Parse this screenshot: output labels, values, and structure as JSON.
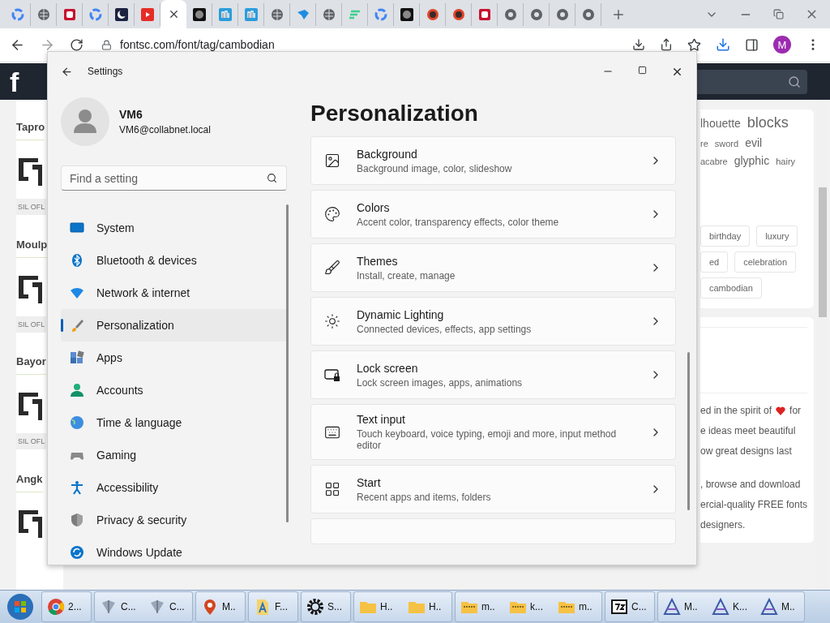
{
  "browser": {
    "tabs": [
      {
        "kind": "google",
        "selected": false
      },
      {
        "kind": "globe",
        "selected": false
      },
      {
        "kind": "red-frame",
        "selected": false
      },
      {
        "kind": "google",
        "selected": false
      },
      {
        "kind": "moon",
        "selected": false
      },
      {
        "kind": "video",
        "selected": false
      },
      {
        "kind": "blank",
        "selected": true
      },
      {
        "kind": "dark-seal",
        "selected": false
      },
      {
        "kind": "blue-tile",
        "selected": false
      },
      {
        "kind": "blue-tile",
        "selected": false
      },
      {
        "kind": "globe",
        "selected": false
      },
      {
        "kind": "blue-bird",
        "selected": false
      },
      {
        "kind": "globe",
        "selected": false
      },
      {
        "kind": "green-lines",
        "selected": false
      },
      {
        "kind": "google",
        "selected": false
      },
      {
        "kind": "dark-seal",
        "selected": false
      },
      {
        "kind": "red-dot",
        "selected": false
      },
      {
        "kind": "red-dot",
        "selected": false
      },
      {
        "kind": "red-frame",
        "selected": false
      },
      {
        "kind": "chrome",
        "selected": false
      },
      {
        "kind": "chrome",
        "selected": false
      },
      {
        "kind": "chrome",
        "selected": false
      },
      {
        "kind": "chrome",
        "selected": false
      }
    ],
    "address": "fontsc.com/font/tag/cambodian",
    "profile": "M"
  },
  "site": {
    "logo": "f",
    "fonts": [
      {
        "title": "Tapro",
        "license": "SIL OFL"
      },
      {
        "title": "Moulp",
        "license": "SIL OFL"
      },
      {
        "title": "Bayor",
        "license": "SIL OFL"
      },
      {
        "title": "Angk"
      }
    ],
    "tag_cloud": [
      [
        {
          "word": "lhouette",
          "kind": "medium"
        },
        {
          "word": "blocks",
          "kind": "large"
        }
      ],
      [
        {
          "word": "re",
          "kind": "small"
        },
        {
          "word": "sword",
          "kind": "small"
        },
        {
          "word": "evil",
          "kind": "medium"
        }
      ],
      [
        {
          "word": "acabre",
          "kind": "small"
        },
        {
          "word": "glyphic",
          "kind": "medium"
        },
        {
          "word": "hairy",
          "kind": "small"
        }
      ]
    ],
    "tags": [
      [
        "birthday",
        "luxury"
      ],
      [
        "ed",
        "celebration"
      ],
      [
        "cambodian"
      ]
    ],
    "about": {
      "first_before": "ed in the spirit of",
      "first_after": "for",
      "lines": [
        "e ideas meet beautiful",
        "ow great designs last"
      ]
    },
    "about2": [
      ", browse and download",
      "ercial-quality FREE fonts",
      "designers."
    ]
  },
  "settings": {
    "title": "Settings",
    "user": {
      "name": "VM6",
      "email": "VM6@collabnet.local"
    },
    "search": {
      "placeholder": "Find a setting"
    },
    "nav": [
      {
        "label": "System",
        "kind": "system",
        "selected": false
      },
      {
        "label": "Bluetooth & devices",
        "kind": "bluetooth",
        "selected": false
      },
      {
        "label": "Network & internet",
        "kind": "network",
        "selected": false
      },
      {
        "label": "Personalization",
        "kind": "personalization",
        "selected": true
      },
      {
        "label": "Apps",
        "kind": "apps",
        "selected": false
      },
      {
        "label": "Accounts",
        "kind": "accounts",
        "selected": false
      },
      {
        "label": "Time & language",
        "kind": "time",
        "selected": false
      },
      {
        "label": "Gaming",
        "kind": "gaming",
        "selected": false
      },
      {
        "label": "Accessibility",
        "kind": "accessibility",
        "selected": false
      },
      {
        "label": "Privacy & security",
        "kind": "privacy",
        "selected": false
      },
      {
        "label": "Windows Update",
        "kind": "update",
        "selected": false
      }
    ],
    "heading": "Personalization",
    "cards": [
      {
        "kind": "background",
        "title": "Background",
        "subtitle": "Background image, color, slideshow"
      },
      {
        "kind": "colors",
        "title": "Colors",
        "subtitle": "Accent color, transparency effects, color theme"
      },
      {
        "kind": "themes",
        "title": "Themes",
        "subtitle": "Install, create, manage"
      },
      {
        "kind": "lighting",
        "title": "Dynamic Lighting",
        "subtitle": "Connected devices, effects, app settings"
      },
      {
        "kind": "lock",
        "title": "Lock screen",
        "subtitle": "Lock screen images, apps, animations"
      },
      {
        "kind": "keyboard",
        "title": "Text input",
        "subtitle": "Touch keyboard, voice typing, emoji and more, input method editor"
      },
      {
        "kind": "start",
        "title": "Start",
        "subtitle": "Recent apps and items, folders"
      }
    ]
  },
  "taskbar": {
    "groups": [
      [
        {
          "kind": "chrome",
          "label": "2..."
        }
      ],
      [
        {
          "kind": "app",
          "label": "C..."
        },
        {
          "kind": "app",
          "label": "C..."
        }
      ],
      [
        {
          "kind": "pin",
          "label": "M.."
        }
      ],
      [
        {
          "kind": "font",
          "label": "F..."
        }
      ],
      [
        {
          "kind": "gear",
          "label": "S..."
        }
      ],
      [
        {
          "kind": "folder",
          "label": "H.."
        },
        {
          "kind": "folder",
          "label": "H.."
        }
      ],
      [
        {
          "kind": "zip",
          "label": "m.."
        },
        {
          "kind": "zip",
          "label": "k..."
        },
        {
          "kind": "zip",
          "label": "m.."
        }
      ],
      [
        {
          "kind": "archiver",
          "label": "C..."
        }
      ],
      [
        {
          "kind": "vector",
          "label": "M.."
        },
        {
          "kind": "vector",
          "label": "K..."
        },
        {
          "kind": "vector",
          "label": "M.."
        }
      ]
    ]
  }
}
